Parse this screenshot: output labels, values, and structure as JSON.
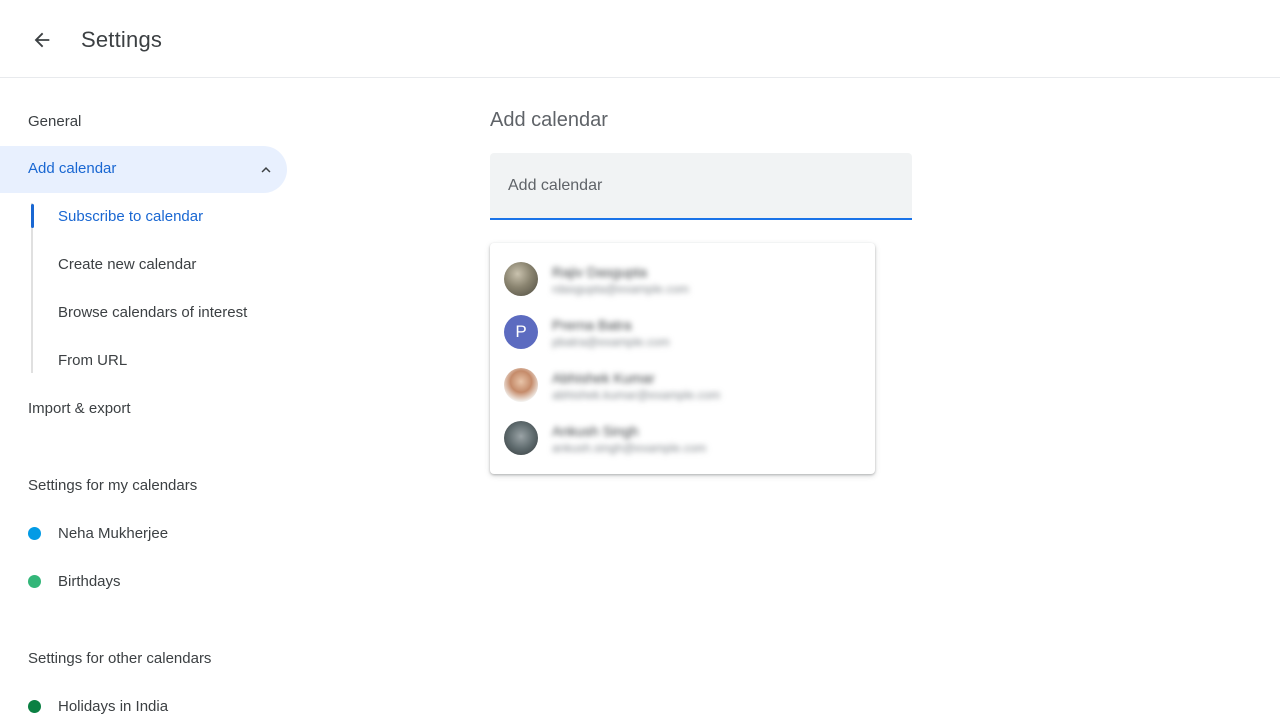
{
  "header": {
    "back_icon": "arrow-back-icon",
    "title": "Settings"
  },
  "sidebar": {
    "general": "General",
    "add_calendar": {
      "label": "Add calendar",
      "expanded": true,
      "chevron_icon": "chevron-up-icon",
      "subitems": [
        {
          "label": "Subscribe to calendar",
          "active": true
        },
        {
          "label": "Create new calendar"
        },
        {
          "label": "Browse calendars of interest"
        },
        {
          "label": "From URL"
        }
      ]
    },
    "import_export": "Import & export",
    "my_calendars": {
      "heading": "Settings for my calendars",
      "items": [
        {
          "label": "Neha Mukherjee",
          "color": "#039be5"
        },
        {
          "label": "Birthdays",
          "color": "#33b679"
        }
      ]
    },
    "other_calendars": {
      "heading": "Settings for other calendars",
      "items": [
        {
          "label": "Holidays in India",
          "color": "#0b8043"
        }
      ]
    }
  },
  "main": {
    "heading": "Add calendar",
    "input": {
      "placeholder": "Add calendar",
      "value": ""
    },
    "suggestions": [
      {
        "avatar": "photo",
        "avatar_color": "#6d6a5a",
        "name": "Rajiv Dasgupta",
        "email": "rdasgupta@example.com"
      },
      {
        "avatar": "letter",
        "letter": "P",
        "avatar_color": "#5c6bc0",
        "name": "Prerna Batra",
        "email": "pbatra@example.com"
      },
      {
        "avatar": "photo",
        "avatar_color": "#c58b6a",
        "name": "Abhishek Kumar",
        "email": "abhishek.kumar@example.com"
      },
      {
        "avatar": "photo",
        "avatar_color": "#5f6b6e",
        "name": "Ankush Singh",
        "email": "ankush.singh@example.com"
      }
    ]
  },
  "colors": {
    "accent": "#1a73e8",
    "active_text": "#1967d2",
    "active_bg": "#e8f0fe"
  }
}
